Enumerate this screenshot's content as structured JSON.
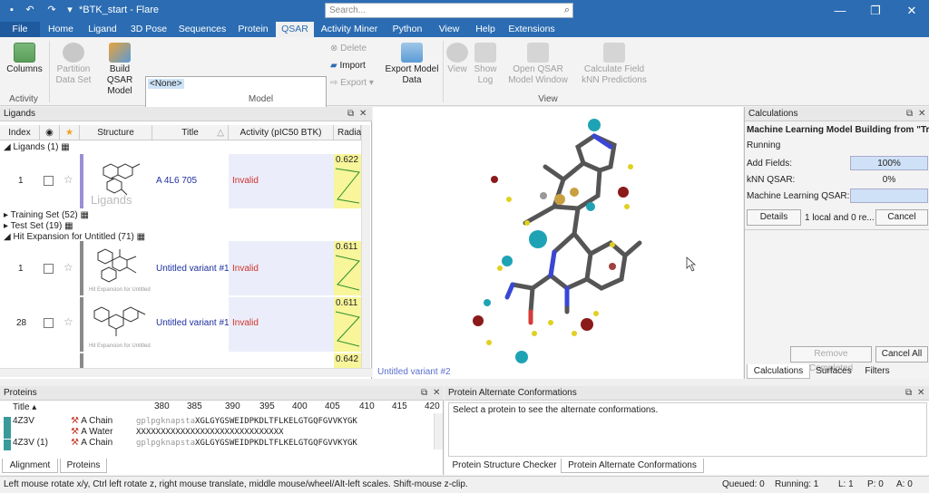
{
  "window": {
    "title": "*BTK_start - Flare",
    "search_placeholder": "Search..."
  },
  "menu": {
    "tabs": [
      "File",
      "Home",
      "Ligand",
      "3D Pose",
      "Sequences",
      "Protein",
      "QSAR",
      "Activity Miner",
      "Python",
      "View",
      "Help",
      "Extensions"
    ],
    "active": "QSAR"
  },
  "ribbon": {
    "columns": "Columns",
    "partition": "Partition Data Set",
    "build": "Build QSAR Model",
    "model_selected": "<None>",
    "delete": "Delete",
    "import": "Import",
    "export": "Export",
    "export_model_data": "Export Model Data",
    "view": "View",
    "show_log": "Show Log",
    "open_qsar": "Open QSAR Model Window",
    "calc_field": "Calculate Field kNN Predictions",
    "groups": {
      "activity": "Activity",
      "model": "Model",
      "view": "View"
    }
  },
  "ligands": {
    "panel_title": "Ligands",
    "columns": [
      "Index",
      "Structure",
      "Title",
      "Activity (pIC50 BTK)",
      "Radia"
    ],
    "groups": {
      "ligands": "Ligands (1)",
      "training": "Training Set (52)",
      "test": "Test Set (19)",
      "hit": "Hit Expansion for Untitled (71)"
    },
    "watermark": "Ligands",
    "rows": [
      {
        "index": "1",
        "title": "A 4L6 705",
        "activity": "Invalid",
        "radial": "0.622"
      },
      {
        "index": "1",
        "title": "Untitled variant #1",
        "activity": "Invalid",
        "radial": "0.611",
        "caption": "Hit Expansion for Untitled"
      },
      {
        "index": "28",
        "title": "Untitled variant #1",
        "activity": "Invalid",
        "radial": "0.611",
        "caption": "Hit Expansion for Untitled"
      },
      {
        "radial": "0.642"
      }
    ]
  },
  "viewer": {
    "label": "Untitled variant #2"
  },
  "calc": {
    "panel_title": "Calculations",
    "job": "Machine Learning Model Building from \"Tr...",
    "status": "Running",
    "add_fields_label": "Add Fields:",
    "add_fields_value": "100%",
    "knn_label": "kNN QSAR:",
    "knn_value": "0%",
    "ml_label": "Machine Learning QSAR:",
    "ml_value": "",
    "details": "Details",
    "info": "1 local and 0 re...",
    "cancel": "Cancel",
    "remove_completed": "Remove Completed",
    "cancel_all": "Cancel All",
    "tabs": [
      "Calculations",
      "Surfaces",
      "Filters"
    ]
  },
  "proteins": {
    "panel_title": "Proteins",
    "title_col": "Title",
    "ruler": [
      "380",
      "385",
      "390",
      "395",
      "400",
      "405",
      "410",
      "415",
      "420"
    ],
    "rows": [
      {
        "name": "4Z3V",
        "chain": "A Chain",
        "seq_pre": "gplpgknapsta",
        "seq": "XGLGYGSWEIDPKDLTFLKELGTGQFGVVKYGK"
      },
      {
        "name": "",
        "chain": "A Water",
        "seq_pre": "",
        "seq": "XXXXXXXXXXXXXXXXXXXXXXXXXXXXXX"
      },
      {
        "name": "4Z3V (1)",
        "chain": "A Chain",
        "seq_pre": "gplpgknapsta",
        "seq": "XGLGYGSWEIDPKDLTFLKELGTGQFGVVKYGK"
      }
    ],
    "tabs": [
      "Alignment",
      "Proteins"
    ]
  },
  "alt": {
    "panel_title": "Protein Alternate Conformations",
    "message": "Select a protein to see the alternate conformations.",
    "tabs": [
      "Protein Structure Checker",
      "Protein Alternate Conformations"
    ]
  },
  "status": {
    "hint": "Left mouse rotate x/y, Ctrl left rotate z, right mouse translate, middle mouse/wheel/Alt-left scales. Shift-mouse z-clip.",
    "queued": "Queued: 0",
    "running": "Running: 1",
    "l": "L: 1",
    "p": "P: 0",
    "a": "A: 0"
  },
  "colors": {
    "brand": "#2b6cb3",
    "invalid": "#d0312d",
    "title_link": "#1c2f9e"
  }
}
